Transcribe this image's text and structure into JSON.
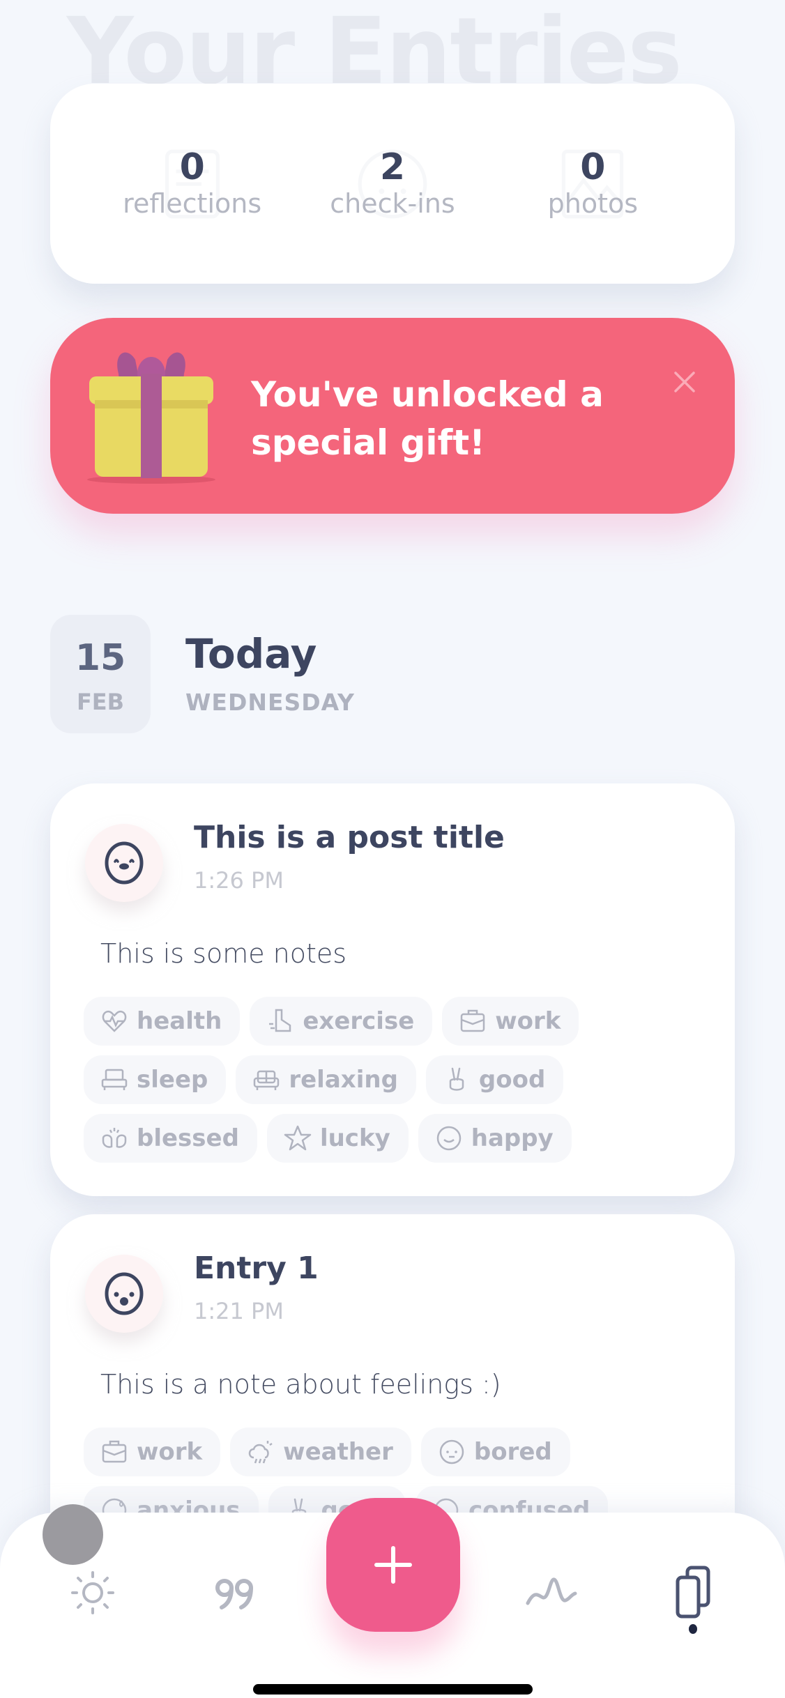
{
  "page": {
    "background_title": "Your Entries"
  },
  "stats": [
    {
      "value": "0",
      "label": "reflections",
      "icon": "journal-icon"
    },
    {
      "value": "2",
      "label": "check-ins",
      "icon": "face-icon"
    },
    {
      "value": "0",
      "label": "photos",
      "icon": "image-icon"
    }
  ],
  "gift_banner": {
    "text": "You've unlocked a special gift!",
    "close_icon": "close-icon",
    "color": "#f4657b"
  },
  "date_header": {
    "day": "15",
    "month": "FEB",
    "title": "Today",
    "weekday": "WEDNESDAY"
  },
  "entries": [
    {
      "mood_icon": "laughing-face-icon",
      "title": "This is a post title",
      "time": "1:26 PM",
      "notes": "This is some notes",
      "tags": [
        {
          "label": "health",
          "icon": "heart-pulse-icon"
        },
        {
          "label": "exercise",
          "icon": "sneaker-icon"
        },
        {
          "label": "work",
          "icon": "briefcase-icon"
        },
        {
          "label": "sleep",
          "icon": "bed-icon"
        },
        {
          "label": "relaxing",
          "icon": "sofa-icon"
        },
        {
          "label": "good",
          "icon": "peace-hand-icon"
        },
        {
          "label": "blessed",
          "icon": "raised-hands-icon"
        },
        {
          "label": "lucky",
          "icon": "star-icon"
        },
        {
          "label": "happy",
          "icon": "smile-icon"
        }
      ]
    },
    {
      "mood_icon": "surprised-face-icon",
      "title": "Entry 1",
      "time": "1:21 PM",
      "notes": "This is a note about feelings :)",
      "tags": [
        {
          "label": "work",
          "icon": "briefcase-icon"
        },
        {
          "label": "weather",
          "icon": "cloud-rain-icon"
        },
        {
          "label": "bored",
          "icon": "bored-face-icon"
        },
        {
          "label": "anxious",
          "icon": "anxious-face-icon"
        },
        {
          "label": "good",
          "icon": "peace-hand-icon"
        },
        {
          "label": "confused",
          "icon": "confused-face-icon"
        }
      ]
    }
  ],
  "tabbar": {
    "tabs": [
      {
        "icon": "sun-icon",
        "active": false
      },
      {
        "icon": "quote-icon",
        "active": false
      },
      {
        "icon": "wave-icon",
        "active": false
      },
      {
        "icon": "entries-icon",
        "active": true
      }
    ],
    "fab_icon": "plus-icon",
    "accent": "#ef5b8c"
  }
}
